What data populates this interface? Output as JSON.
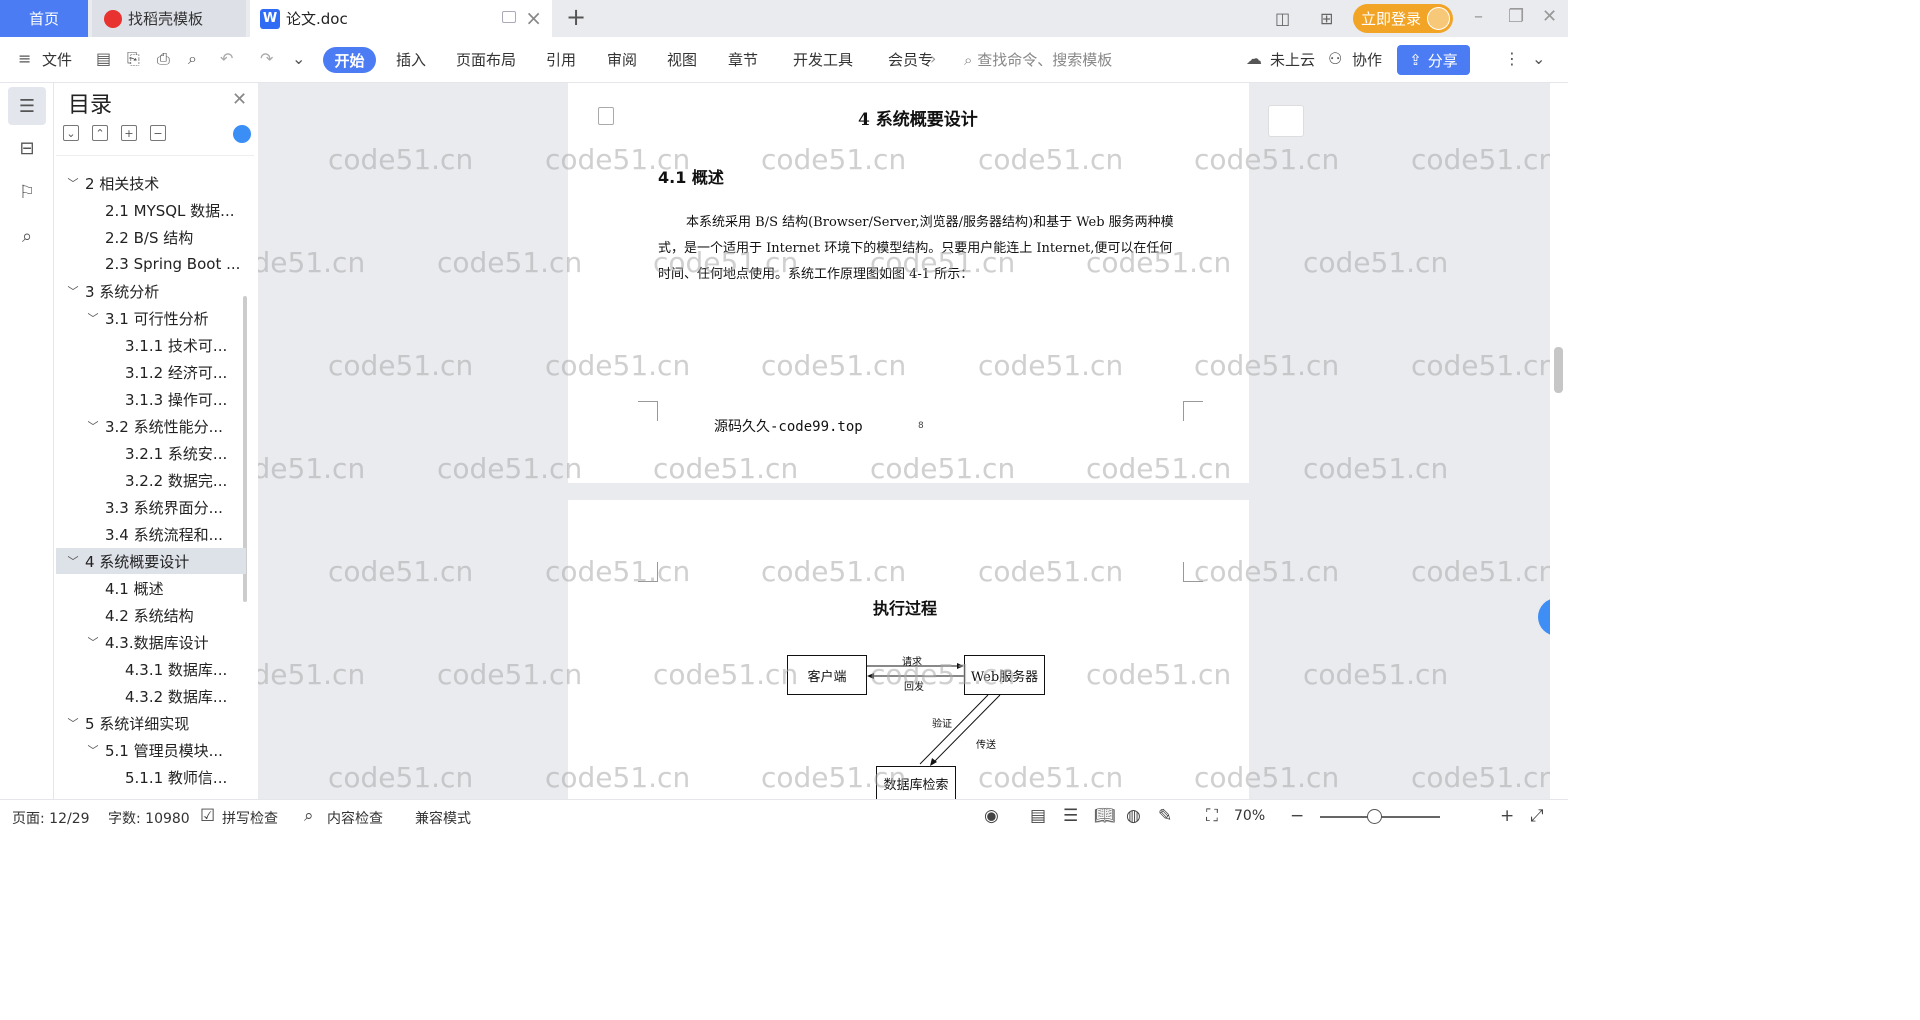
{
  "tabs": {
    "home": "首页",
    "template": "找稻壳模板",
    "doc_icon": "W",
    "doc": "论文.doc",
    "add": "+"
  },
  "topbar": {
    "login": "立即登录",
    "icons": [
      "layout-icon",
      "grid-apps-icon"
    ],
    "window": [
      "–",
      "❐",
      "✕"
    ]
  },
  "toolbar": {
    "file": "文件",
    "menus": [
      "开始",
      "插入",
      "页面布局",
      "引用",
      "审阅",
      "视图",
      "章节",
      "开发工具",
      "会员专"
    ],
    "search_placeholder": "查找命令、搜索模板",
    "cloud": "未上云",
    "collab": "协作",
    "share": "分享"
  },
  "toc": {
    "title": "目录",
    "items": [
      {
        "label": "2 相关技术",
        "level": 0,
        "chevron": "﹀"
      },
      {
        "label": "2.1 MYSQL 数据...",
        "level": 1,
        "chevron": ""
      },
      {
        "label": "2.2 B/S 结构",
        "level": 1,
        "chevron": ""
      },
      {
        "label": "2.3 Spring Boot ...",
        "level": 1,
        "chevron": ""
      },
      {
        "label": "3 系统分析",
        "level": 0,
        "chevron": "﹀"
      },
      {
        "label": "3.1 可行性分析",
        "level": 1,
        "chevron": "﹀"
      },
      {
        "label": "3.1.1 技术可...",
        "level": 2,
        "chevron": ""
      },
      {
        "label": "3.1.2 经济可...",
        "level": 2,
        "chevron": ""
      },
      {
        "label": "3.1.3 操作可...",
        "level": 2,
        "chevron": ""
      },
      {
        "label": "3.2 系统性能分...",
        "level": 1,
        "chevron": "﹀"
      },
      {
        "label": "3.2.1  系统安...",
        "level": 2,
        "chevron": ""
      },
      {
        "label": "3.2.2  数据完...",
        "level": 2,
        "chevron": ""
      },
      {
        "label": "3.3 系统界面分...",
        "level": 1,
        "chevron": ""
      },
      {
        "label": "3.4 系统流程和...",
        "level": 1,
        "chevron": ""
      },
      {
        "label": "4 系统概要设计",
        "level": 0,
        "chevron": "﹀",
        "selected": true
      },
      {
        "label": "4.1 概述",
        "level": 1,
        "chevron": ""
      },
      {
        "label": "4.2 系统结构",
        "level": 1,
        "chevron": ""
      },
      {
        "label": "4.3.数据库设计",
        "level": 1,
        "chevron": "﹀"
      },
      {
        "label": "4.3.1 数据库...",
        "level": 2,
        "chevron": ""
      },
      {
        "label": "4.3.2 数据库...",
        "level": 2,
        "chevron": ""
      },
      {
        "label": "5 系统详细实现",
        "level": 0,
        "chevron": "﹀"
      },
      {
        "label": "5.1  管理员模块...",
        "level": 1,
        "chevron": "﹀"
      },
      {
        "label": "5.1.1  教师信...",
        "level": 2,
        "chevron": ""
      }
    ]
  },
  "document": {
    "heading": "4 系统概要设计",
    "subheading": "4.1 概述",
    "paragraph": "本系统采用 B/S 结构(Browser/Server,浏览器/服务器结构)和基于 Web 服务两种模式，是一个适用于 Internet 环境下的模型结构。只要用户能连上 Internet,便可以在任何时间、任何地点使用。系统工作原理图如图 4-1 所示：",
    "footer": "源码久久-code99.top",
    "page_number": "8",
    "watermark": "code51.cn",
    "diagram": {
      "title": "执行过程",
      "client": "客户端",
      "server": "Web服务器",
      "db": "数据库检索",
      "request": "请求",
      "reply": "回发",
      "verify": "验证",
      "transmit": "传送"
    }
  },
  "status": {
    "page": "页面: 12/29",
    "words": "字数: 10980",
    "spell": "拼写检查",
    "content": "内容检查",
    "compat": "兼容模式",
    "zoom": "70%"
  }
}
